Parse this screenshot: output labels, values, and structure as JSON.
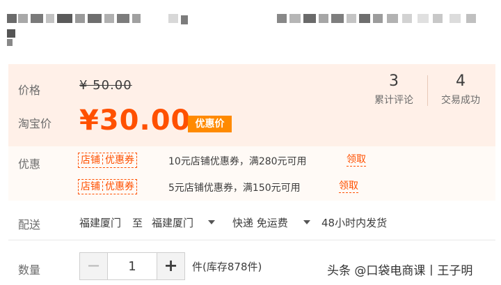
{
  "price": {
    "label": "价格",
    "original": "¥ 50.00",
    "promo_label": "淘宝价",
    "promo_price": "¥30.00",
    "promo_badge": "优惠价"
  },
  "stats": [
    {
      "value": "3",
      "caption": "累计评论"
    },
    {
      "value": "4",
      "caption": "交易成功"
    }
  ],
  "coupons": {
    "label": "优惠",
    "tag_left": "店铺",
    "tag_right": "优惠券",
    "items": [
      {
        "text": "10元店铺优惠券，满280元可用",
        "claim": "领取"
      },
      {
        "text": "5元店铺优惠券，满150元可用",
        "claim": "领取"
      }
    ]
  },
  "delivery": {
    "label": "配送",
    "from": "福建厦门",
    "to_word": "至",
    "to": "福建厦门",
    "method": "快递 免运费",
    "ship_time": "48小时内发货"
  },
  "quantity": {
    "label": "数量",
    "minus": "−",
    "value": "1",
    "plus": "+",
    "stock": "件(库存878件)"
  },
  "watermark": "头条 @口袋电商课丨王子明",
  "colors": {
    "accent": "#ff5000",
    "badge": "#ff8a00",
    "panel_bg": "#fff0e8"
  }
}
